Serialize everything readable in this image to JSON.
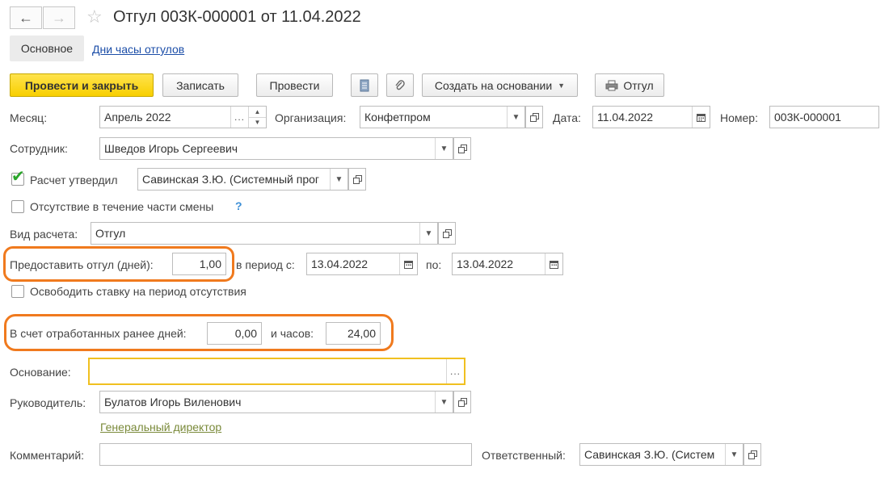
{
  "header": {
    "back_icon": "arrow-left-icon",
    "forward_icon": "arrow-right-icon",
    "favorite_icon": "star-icon",
    "title": "Отгул 003К-000001 от 11.04.2022"
  },
  "tabs": {
    "main": "Основное",
    "days_hours": "Дни часы отгулов"
  },
  "toolbar": {
    "post_close": "Провести и закрыть",
    "save": "Записать",
    "post": "Провести",
    "create_based": "Создать на основании",
    "print": "Отгул"
  },
  "form": {
    "month_label": "Месяц:",
    "month_value": "Апрель 2022",
    "org_label": "Организация:",
    "org_value": "Конфетпром",
    "date_label": "Дата:",
    "date_value": "11.04.2022",
    "number_label": "Номер:",
    "number_value": "003К-000001",
    "employee_label": "Сотрудник:",
    "employee_value": "Шведов Игорь Сергеевич",
    "approved_label": "Расчет утвердил",
    "approved_checked": true,
    "approver_value": "Савинская З.Ю. (Системный прог",
    "partial_shift_label": "Отсутствие в течение части смены",
    "help_mark": "?",
    "calc_type_label": "Вид расчета:",
    "calc_type_value": "Отгул",
    "grant_days_label": "Предоставить отгул (дней):",
    "grant_days_value": "1,00",
    "period_from_label": "в период с:",
    "period_from_value": "13.04.2022",
    "period_to_label": "по:",
    "period_to_value": "13.04.2022",
    "release_rate_label": "Освободить ставку на период отсутствия",
    "worked_days_label": "В счет отработанных ранее дней:",
    "worked_days_value": "0,00",
    "hours_label": "и часов:",
    "hours_value": "24,00",
    "basis_label": "Основание:",
    "basis_value": "",
    "manager_label": "Руководитель:",
    "manager_value": "Булатов Игорь Виленович",
    "manager_position": "Генеральный директор",
    "comment_label": "Комментарий:",
    "comment_value": "",
    "responsible_label": "Ответственный:",
    "responsible_value": "Савинская З.Ю. (Систем"
  },
  "colors": {
    "primary_button": "#f8cf00",
    "highlight_ring": "#f07a1e",
    "link": "#1c4ea8",
    "checkmark": "#2aa52a"
  }
}
